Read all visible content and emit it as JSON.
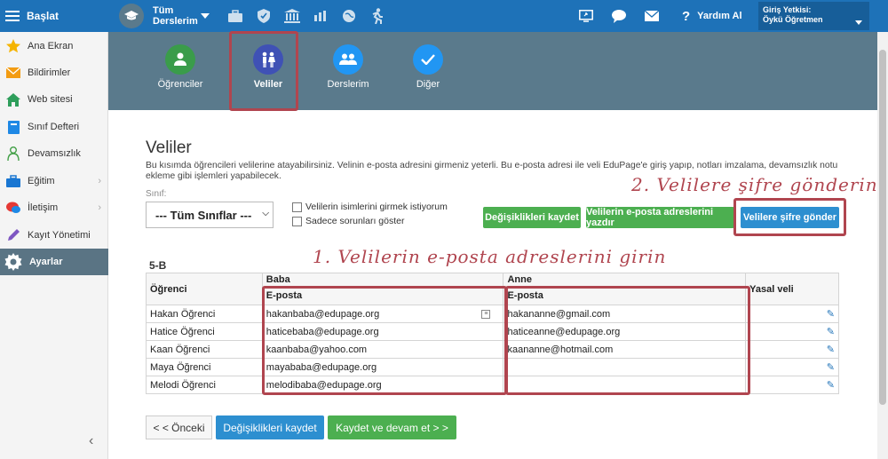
{
  "topbar": {
    "start_label": "Başlat",
    "courses_label_1": "Tüm",
    "courses_label_2": "Derslerim",
    "help_label": "Yardım Al",
    "login_title": "Giriş Yetkisi:",
    "login_user": "Öykü Öğretmen"
  },
  "sidebar": {
    "items": [
      {
        "label": "Ana Ekran",
        "icon": "star-icon"
      },
      {
        "label": "Bildirimler",
        "icon": "envelope-icon"
      },
      {
        "label": "Web sitesi",
        "icon": "home-icon"
      },
      {
        "label": "Sınıf Defteri",
        "icon": "notebook-icon"
      },
      {
        "label": "Devamsızlık",
        "icon": "person-icon"
      },
      {
        "label": "Eğitim",
        "icon": "briefcase-icon"
      },
      {
        "label": "İletişim",
        "icon": "chat-icon"
      },
      {
        "label": "Kayıt Yönetimi",
        "icon": "pencil-icon"
      },
      {
        "label": "Ayarlar",
        "icon": "gear-icon"
      }
    ]
  },
  "iconbar": {
    "items": [
      {
        "label": "Öğrenciler",
        "color": "#3a9c4a"
      },
      {
        "label": "Veliler",
        "color": "#3f51b5"
      },
      {
        "label": "Derslerim",
        "color": "#2196f3"
      },
      {
        "label": "Diğer",
        "color": "#2196f3"
      }
    ]
  },
  "page": {
    "title": "Veliler",
    "description_line1": "Bu kısımda öğrencileri velilerine atayabilirsiniz. Velinin e-posta adresini girmeniz yeterli. Bu e-posta adresi ile veli EduPage'e giriş yapıp, notları imzalama, devamsızlık notu",
    "description_line2": "ekleme gibi işlemleri yapabilecek.",
    "class_label": "Sınıf:",
    "class_select": "--- Tüm Sınıflar ---",
    "checkbox1": "Velilerin isimlerini girmek istiyorum",
    "checkbox2": "Sadece sorunları göster",
    "save_changes": "Değişiklikleri kaydet",
    "print_emails": "Velilerin e-posta adreslerini yazdır",
    "send_passwords": "Velilere şifre gönder",
    "annotation1": "1. Velilerin e-posta adreslerini girin",
    "annotation2": "2. Velilere şifre gönderin",
    "class_name": "5-B"
  },
  "table": {
    "col_student": "Öğrenci",
    "col_father": "Baba",
    "col_mother": "Anne",
    "col_guardian": "Yasal veli",
    "sub_email": "E-posta",
    "rows": [
      {
        "student": "Hakan Öğrenci",
        "father": "hakanbaba@edupage.org",
        "mother": "hakananne@gmail.com"
      },
      {
        "student": "Hatice Öğrenci",
        "father": "haticebaba@edupage.org",
        "mother": "haticeanne@edupage.org"
      },
      {
        "student": "Kaan Öğrenci",
        "father": "kaanbaba@yahoo.com",
        "mother": "kaananne@hotmail.com"
      },
      {
        "student": "Maya Öğrenci",
        "father": "mayababa@edupage.org",
        "mother": ""
      },
      {
        "student": "Melodi Öğrenci",
        "father": "melodibaba@edupage.org",
        "mother": ""
      }
    ]
  },
  "footer": {
    "prev": "< < Önceki",
    "save": "Değişiklikleri kaydet",
    "save_continue": "Kaydet ve devam et > >"
  }
}
